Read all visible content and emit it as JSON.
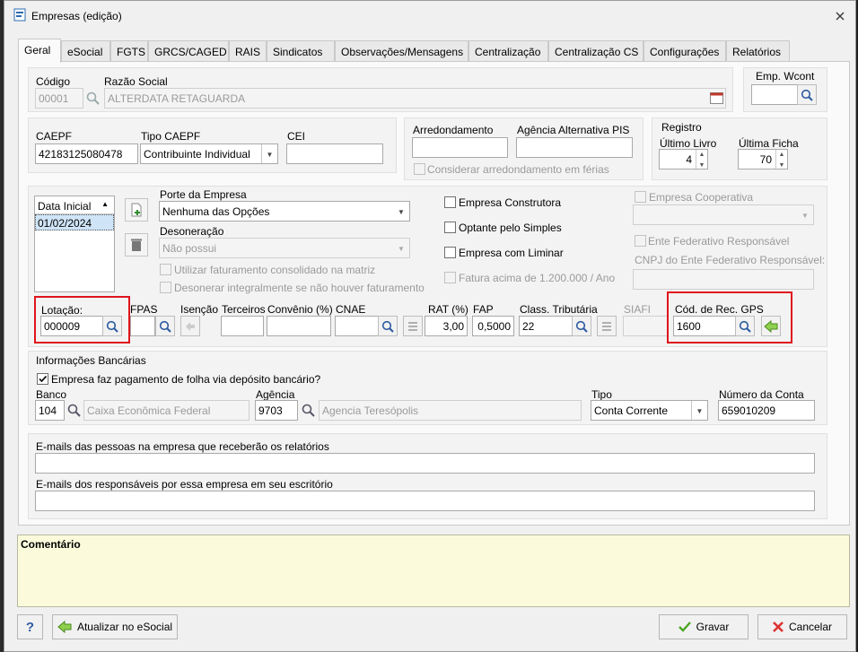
{
  "window": {
    "title": "Empresas (edição)"
  },
  "tabs": [
    "Geral",
    "eSocial",
    "FGTS",
    "GRCS/CAGED",
    "RAIS",
    "Sindicatos",
    "Observações/Mensagens",
    "Centralização",
    "Centralização CS",
    "Configurações",
    "Relatórios"
  ],
  "empresa": {
    "codigo_label": "Código",
    "codigo": "00001",
    "razao_label": "Razão Social",
    "razao": "ALTERDATA RETAGUARDA",
    "wcont_label": "Emp. Wcont",
    "wcont": ""
  },
  "caepf": {
    "caepf_label": "CAEPF",
    "caepf": "42183125080478",
    "tipo_label": "Tipo CAEPF",
    "tipo": "Contribuinte Individual",
    "cei_label": "CEI",
    "cei": ""
  },
  "arred": {
    "arred_label": "Arredondamento",
    "arred": "",
    "agencia_label": "Agência Alternativa PIS",
    "agencia": "",
    "ferias_label": "Considerar arredondamento em férias"
  },
  "registro": {
    "title": "Registro",
    "livro_label": "Último Livro",
    "livro": "4",
    "ficha_label": "Última Ficha",
    "ficha": "70"
  },
  "porte": {
    "list_header": "Data Inicial",
    "list_item": "01/02/2024",
    "porte_label": "Porte da Empresa",
    "porte": "Nenhuma das Opções",
    "deson_label": "Desoneração",
    "deson": "Não possui",
    "fat_consol": "Utilizar faturamento consolidado na matriz",
    "deson_integral": "Desonerar integralmente se não houver faturamento"
  },
  "checks": {
    "construtora": "Empresa Construtora",
    "simples": "Optante pelo Simples",
    "liminar": "Empresa com Liminar",
    "fatura": "Fatura acima de 1.200.000 / Ano",
    "cooperativa": "Empresa Cooperativa",
    "ente": "Ente Federativo Responsável",
    "cnpj_ente": "CNPJ do Ente Federativo Responsável:"
  },
  "fiscal": {
    "lotacao_label": "Lotação:",
    "lotacao": "000009",
    "fpas_label": "FPAS",
    "isencao_label": "Isenção",
    "terceiros_label": "Terceiros",
    "convenio_label": "Convênio (%)",
    "cnae_label": "CNAE",
    "rat_label": "RAT (%)",
    "rat": "3,00",
    "fap_label": "FAP",
    "fap": "0,5000",
    "class_label": "Class. Tributária",
    "class": "22",
    "siafi_label": "SIAFI",
    "gps_label": "Cód. de Rec. GPS",
    "gps": "1600"
  },
  "banco": {
    "title": "Informações Bancárias",
    "deposito": "Empresa faz pagamento de folha via depósito bancário?",
    "banco_label": "Banco",
    "banco": "104",
    "banco_nome": "Caixa Econômica Federal",
    "agencia_label": "Agência",
    "agencia": "9703",
    "agencia_nome": "Agencia Teresópolis",
    "tipo_label": "Tipo",
    "tipo": "Conta Corrente",
    "conta_label": "Número da Conta",
    "conta": "659010209"
  },
  "emails": {
    "empresa_label": "E-mails das pessoas na empresa que receberão os relatórios",
    "escritorio_label": "E-mails dos responsáveis por essa empresa em seu escritório"
  },
  "comentario": {
    "label": "Comentário"
  },
  "footer": {
    "help": "?",
    "esocial": "Atualizar no eSocial",
    "gravar": "Gravar",
    "cancelar": "Cancelar"
  },
  "colors": {
    "highlight": "#e0141c",
    "comment_bg": "#fbfbdc",
    "selection": "#cfe4f7"
  }
}
